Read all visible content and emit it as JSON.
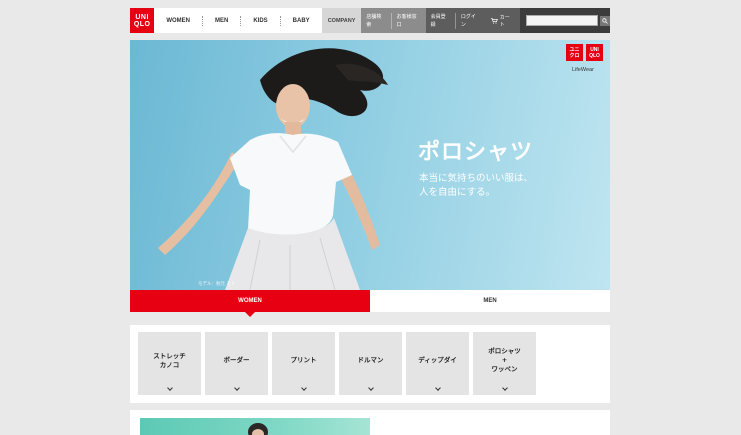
{
  "brand": {
    "logo_line1": "UNI",
    "logo_line2": "QLO",
    "accent": "#e60012"
  },
  "nav": {
    "items": [
      {
        "label": "WOMEN"
      },
      {
        "label": "MEN"
      },
      {
        "label": "KIDS"
      },
      {
        "label": "BABY"
      }
    ],
    "company": "COMPANY",
    "util_links": [
      "店舗検索",
      "お客様窓口"
    ],
    "account_links": [
      "会員登録",
      "ログイン"
    ],
    "cart": "カート",
    "search_placeholder": "",
    "search_icon": "magnifier-icon"
  },
  "hero": {
    "title": "ポロシャツ",
    "subtitle_line1": "本当に気持ちのいい服は、",
    "subtitle_line2": "人を自由にする。",
    "caption": "モデル：秋元 モト",
    "lifewear_jp_line1": "ユニ",
    "lifewear_jp_line2": "クロ",
    "lifewear_en_line1": "UNI",
    "lifewear_en_line2": "QLO",
    "lifewear_text": "LifeWear"
  },
  "tabs": [
    {
      "label": "WOMEN",
      "active": true
    },
    {
      "label": "MEN",
      "active": false
    }
  ],
  "categories": [
    {
      "label": "ストレッチ\nカノコ"
    },
    {
      "label": "ボーダー"
    },
    {
      "label": "プリント"
    },
    {
      "label": "ドルマン"
    },
    {
      "label": "ディップダイ"
    },
    {
      "label": "ポロシャツ\n+\nワッペン"
    }
  ]
}
